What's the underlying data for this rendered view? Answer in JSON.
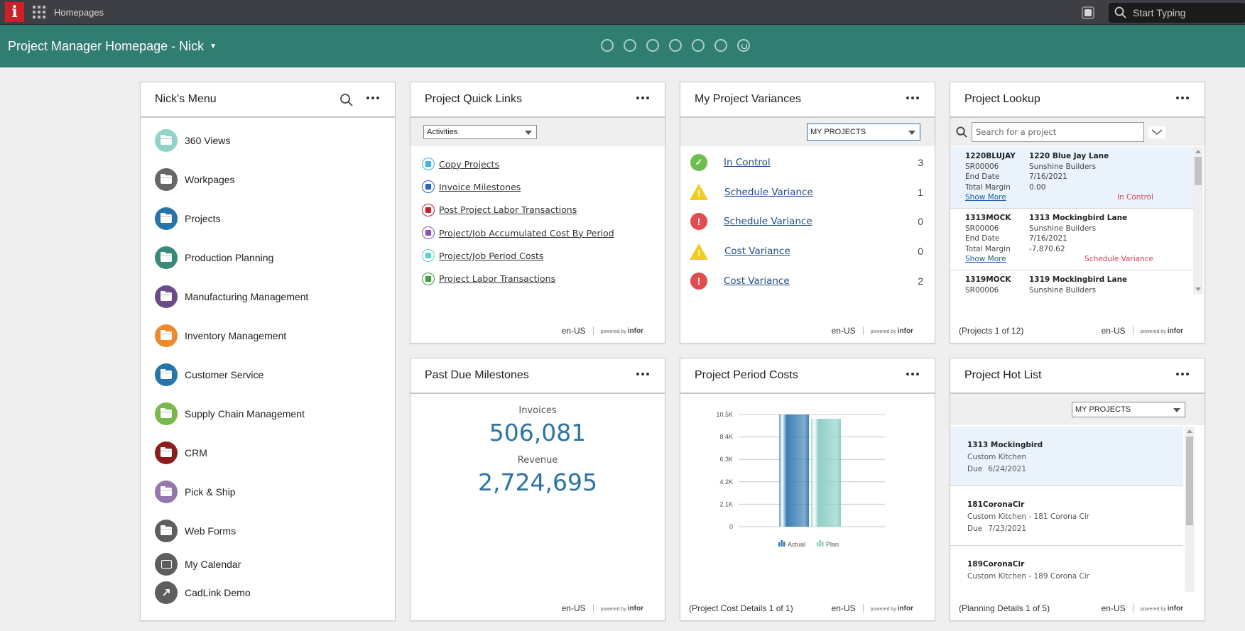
{
  "topbar": {
    "logo": "i",
    "app_label": "Homepages",
    "search_placeholder": "Start Typing"
  },
  "header": {
    "title": "Project Manager Homepage - Nick",
    "page_dots": 7,
    "active_page": 7
  },
  "menu": {
    "title": "Nick's Menu",
    "items": [
      {
        "label": "360 Views",
        "color": "#8fd3c9",
        "icon": "folder-icon"
      },
      {
        "label": "Workpages",
        "color": "#666666",
        "icon": "folder-icon"
      },
      {
        "label": "Projects",
        "color": "#2574aa",
        "icon": "folder-icon"
      },
      {
        "label": "Production Planning",
        "color": "#3a8a7c",
        "icon": "folder-icon"
      },
      {
        "label": "Manufacturing Management",
        "color": "#6b4c8a",
        "icon": "folder-icon"
      },
      {
        "label": "Inventory Management",
        "color": "#ed8a2a",
        "icon": "folder-icon"
      },
      {
        "label": "Customer Service",
        "color": "#2574aa",
        "icon": "folder-icon"
      },
      {
        "label": "Supply Chain Management",
        "color": "#79b94a",
        "icon": "folder-icon"
      },
      {
        "label": "CRM",
        "color": "#8c1d1d",
        "icon": "folder-icon"
      },
      {
        "label": "Pick & Ship",
        "color": "#9477ab",
        "icon": "folder-icon"
      },
      {
        "label": "Web Forms",
        "color": "#5e5e5e",
        "icon": "folder-icon"
      },
      {
        "label": "My Calendar",
        "color": "#5e5e5e",
        "icon": "calendar-icon"
      },
      {
        "label": "CadLink Demo",
        "color": "#5e5e5e",
        "icon": "external-link-icon"
      }
    ]
  },
  "quick_links": {
    "title": "Project Quick Links",
    "filter": "Activities",
    "items": [
      {
        "label": "Copy Projects",
        "color": "#3bb4e6"
      },
      {
        "label": "Invoice Milestones",
        "color": "#2c62d6"
      },
      {
        "label": "Post Project Labor Transactions",
        "color": "#c8202a"
      },
      {
        "label": "Project/Job Accumulated Cost By Period",
        "color": "#8a4fc2"
      },
      {
        "label": "Project/Job Period Costs",
        "color": "#5ed0c4"
      },
      {
        "label": "Project Labor Transactions",
        "color": "#3aa33a"
      }
    ],
    "locale": "en-US"
  },
  "variances": {
    "title": "My Project Variances",
    "filter": "MY PROJECTS",
    "rows": [
      {
        "label": "In Control",
        "status": "ok",
        "count": "3"
      },
      {
        "label": "Schedule Variance",
        "status": "warning",
        "count": "1"
      },
      {
        "label": "Schedule Variance",
        "status": "error",
        "count": "0"
      },
      {
        "label": "Cost Variance",
        "status": "warning",
        "count": "0"
      },
      {
        "label": "Cost Variance",
        "status": "error",
        "count": "2"
      }
    ],
    "locale": "en-US"
  },
  "lookup": {
    "title": "Project Lookup",
    "search_placeholder": "Search for a project",
    "projects": [
      {
        "code": "1220BLUJAY",
        "name": "1220 Blue Jay Lane",
        "customer_id": "SR00006",
        "customer": "Sunshine Builders",
        "end_date_label": "End Date",
        "end_date": "7/16/2021",
        "margin_label": "Total Margin",
        "margin": "0.00",
        "more": "Show More",
        "status": "In Control"
      },
      {
        "code": "1313MOCK",
        "name": "1313 Mockingbird Lane",
        "customer_id": "SR00006",
        "customer": "Sunshine Builders",
        "end_date_label": "End Date",
        "end_date": "7/16/2021",
        "margin_label": "Total Margin",
        "margin": "-7,870.62",
        "more": "Show More",
        "status": "Schedule Variance"
      },
      {
        "code": "1319MOCK",
        "name": "1319 Mockingbird Lane",
        "customer_id": "SR00006",
        "customer": "Sunshine Builders",
        "end_date_label": "",
        "end_date": "",
        "margin_label": "",
        "margin": "",
        "more": "",
        "status": ""
      }
    ],
    "footer": "(Projects 1 of 12)",
    "locale": "en-US"
  },
  "past_due": {
    "title": "Past Due Milestones",
    "invoices_label": "Invoices",
    "invoices_value": "506,081",
    "revenue_label": "Revenue",
    "revenue_value": "2,724,695",
    "locale": "en-US"
  },
  "period_costs": {
    "title": "Project Period Costs",
    "footer": "(Project Cost Details 1 of 1)",
    "locale": "en-US"
  },
  "chart_data": {
    "type": "bar",
    "title": "",
    "categories": [
      ""
    ],
    "series": [
      {
        "name": "Actual",
        "values": [
          10500
        ],
        "color": "#3a7fb2"
      },
      {
        "name": "Plan",
        "values": [
          10100
        ],
        "color": "#8fcfc6"
      }
    ],
    "yticks": [
      "0",
      "2.1K",
      "4.2K",
      "6.3K",
      "8.4K",
      "10.5K"
    ],
    "ylim": [
      0,
      10500
    ],
    "xlabel": "",
    "ylabel": "",
    "grid": true,
    "legend": "bottom"
  },
  "hot_list": {
    "title": "Project Hot List",
    "filter": "MY PROJECTS",
    "items": [
      {
        "title": "1313 Mockingbird",
        "desc": "Custom Kitchen",
        "due_label": "Due",
        "due": "6/24/2021"
      },
      {
        "title": "181CoronaCir",
        "desc": "Custom Kitchen - 181 Corona Cir",
        "due_label": "Due",
        "due": "7/23/2021"
      },
      {
        "title": "189CoronaCir",
        "desc": "Custom Kitchen - 189 Corona Cir",
        "due_label": "",
        "due": ""
      }
    ],
    "footer": "(Planning Details 1 of 5)",
    "locale": "en-US"
  },
  "powered_by": {
    "prefix": "powered by",
    "brand": "infor"
  }
}
